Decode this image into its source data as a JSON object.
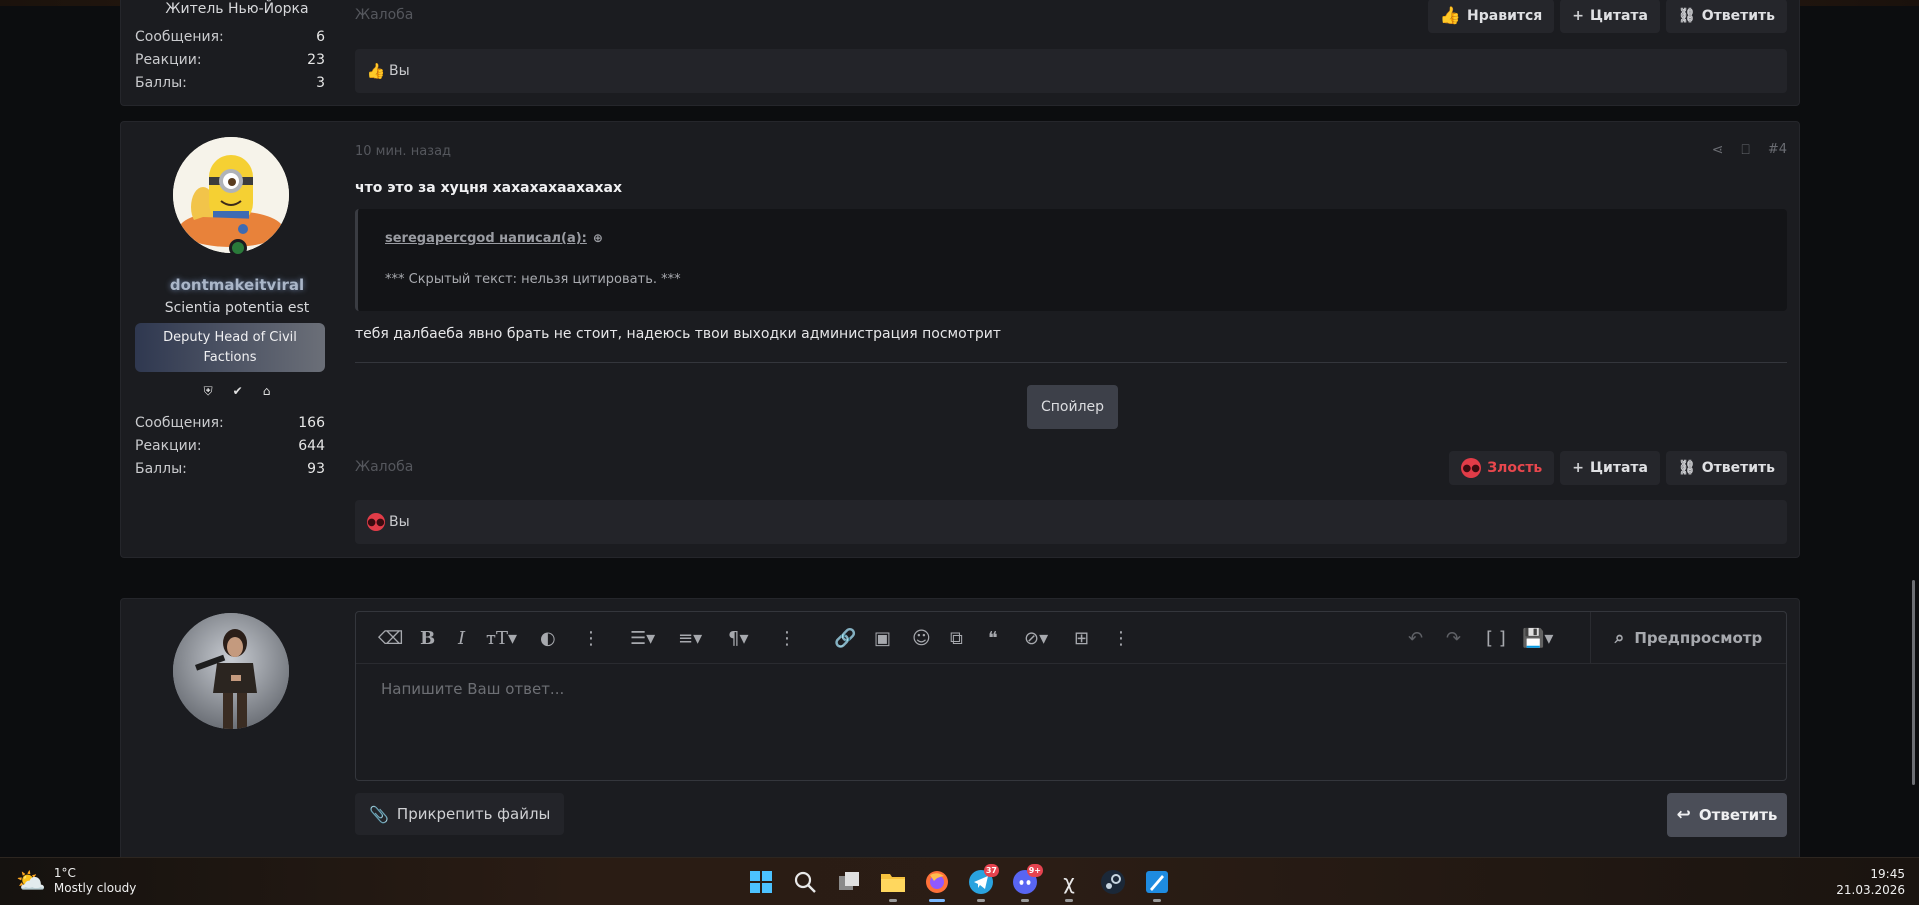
{
  "prev_post": {
    "user_title": "Житель Нью-Йорка",
    "stats": [
      {
        "label": "Сообщения:",
        "value": "6"
      },
      {
        "label": "Реакции:",
        "value": "23"
      },
      {
        "label": "Баллы:",
        "value": "3"
      }
    ],
    "report_label": "Жалоба",
    "reaction_label": "Нравится",
    "quote_label": "Цитата",
    "reply_label": "Ответить",
    "reactions_bar_text": "Вы"
  },
  "post": {
    "username": "dontmakeitviral",
    "user_title": "Scientia potentia est",
    "banner": "Deputy Head of Civil Factions",
    "stats": [
      {
        "label": "Сообщения:",
        "value": "166"
      },
      {
        "label": "Реакции:",
        "value": "644"
      },
      {
        "label": "Баллы:",
        "value": "93"
      }
    ],
    "time": "10 мин. назад",
    "post_number": "#4",
    "headline": "что это за хуцня хахахахаахахах",
    "quote_author": "seregapercgod написал(а):",
    "quote_text": "*** Скрытый текст: нельзя цитировать. ***",
    "body": "тебя далбаеба явно брать не стоит, надеюсь твои выходки администрация посмотрит",
    "spoiler_label": "Спойлер",
    "report_label": "Жалоба",
    "reaction_label": "Злость",
    "quote_label": "Цитата",
    "reply_label": "Ответить",
    "reactions_bar_text": "Вы"
  },
  "reply_box": {
    "placeholder": "Напишите Ваш ответ...",
    "preview_label": "Предпросмотр",
    "attach_label": "Прикрепить файлы",
    "submit_label": "Ответить"
  },
  "taskbar": {
    "weather_temp": "1°C",
    "weather_desc": "Mostly cloudy",
    "time": "19:45",
    "date": "21.03.2026",
    "telegram_badge": "37",
    "discord_badge": "9+"
  },
  "colors": {
    "background": "#0c0d0f",
    "panel": "#1b1c20",
    "angry": "#e8474d",
    "banner_gradient_start": "#2f3850",
    "banner_gradient_end": "#6b6f78"
  }
}
